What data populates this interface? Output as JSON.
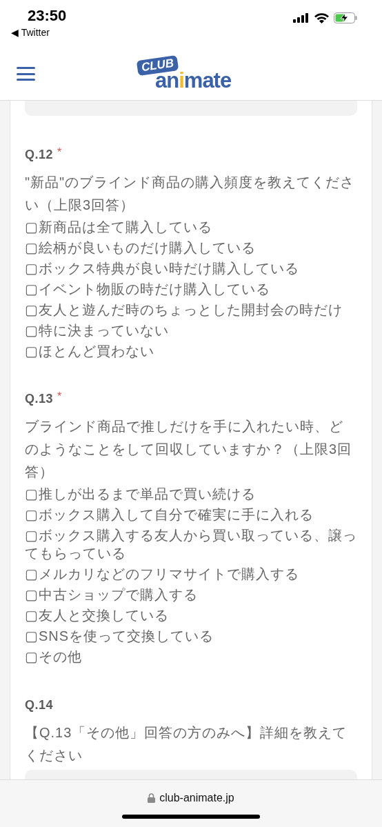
{
  "status_bar": {
    "time": "23:50",
    "back_app": "◀ Twitter"
  },
  "header": {
    "logo": {
      "badge": "CLUB",
      "name_parts": [
        {
          "text": "an",
          "accent": false
        },
        {
          "text": "i",
          "accent": true
        },
        {
          "text": "mate",
          "accent": false
        }
      ]
    }
  },
  "questions": [
    {
      "number": "Q.12",
      "required_mark": "*",
      "text": "\"新品\"のブラインド商品の購入頻度を教えてください（上限3回答）",
      "options": [
        "▢新商品は全て購入している",
        "▢絵柄が良いものだけ購入している",
        "▢ボックス特典が良い時だけ購入している",
        "▢イベント物販の時だけ購入している",
        "▢友人と遊んだ時のちょっとした開封会の時だけ",
        "▢特に決まっていない",
        "▢ほとんど買わない"
      ]
    },
    {
      "number": "Q.13",
      "required_mark": "*",
      "text": "ブラインド商品で推しだけを手に入れたい時、どのようなことをして回収していますか？（上限3回答）",
      "options": [
        "▢推しが出るまで単品で買い続ける",
        "▢ボックス購入して自分で確実に手に入れる",
        "▢ボックス購入する友人から買い取っている、譲ってもらっている",
        "▢メルカリなどのフリマサイトで購入する",
        "▢中古ショップで購入する",
        "▢友人と交換している",
        "▢SNSを使って交換している",
        "▢その他"
      ]
    },
    {
      "number": "Q.14",
      "text": "【Q.13「その他」回答の方のみへ】詳細を教えてください",
      "answer_field": true
    }
  ],
  "browser_bar": {
    "url": "club-animate.jp"
  }
}
